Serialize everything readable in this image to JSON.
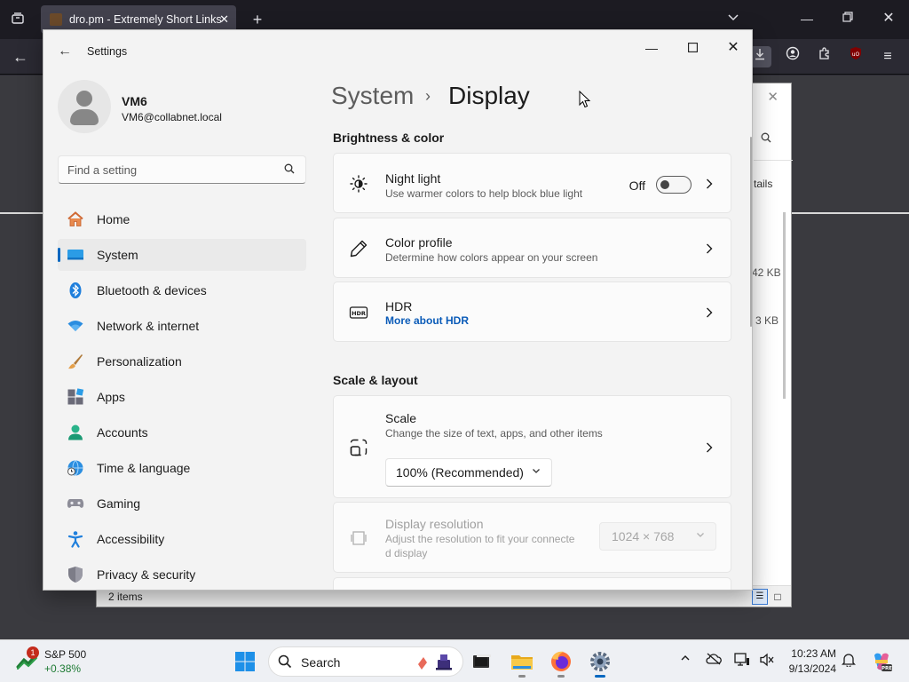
{
  "browser": {
    "tab_title": "dro.pm - Extremely Short Links",
    "downloads": {
      "details_label": "tails",
      "size_1": "42 KB",
      "size_2": "3 KB",
      "status": "2 items"
    }
  },
  "settings": {
    "app_title": "Settings",
    "user": {
      "name": "VM6",
      "email": "VM6@collabnet.local"
    },
    "search": {
      "placeholder": "Find a setting"
    },
    "nav": [
      {
        "label": "Home"
      },
      {
        "label": "System"
      },
      {
        "label": "Bluetooth & devices"
      },
      {
        "label": "Network & internet"
      },
      {
        "label": "Personalization"
      },
      {
        "label": "Apps"
      },
      {
        "label": "Accounts"
      },
      {
        "label": "Time & language"
      },
      {
        "label": "Gaming"
      },
      {
        "label": "Accessibility"
      },
      {
        "label": "Privacy & security"
      }
    ],
    "breadcrumb": {
      "parent": "System",
      "separator": "›",
      "current": "Display"
    },
    "sections": {
      "brightness": {
        "title": "Brightness & color",
        "night_light": {
          "title": "Night light",
          "subtitle": "Use warmer colors to help block blue light",
          "state": "Off"
        },
        "color_profile": {
          "title": "Color profile",
          "subtitle": "Determine how colors appear on your screen"
        },
        "hdr": {
          "title": "HDR",
          "link": "More about HDR"
        }
      },
      "scale_layout": {
        "title": "Scale & layout",
        "scale": {
          "title": "Scale",
          "subtitle": "Change the size of text, apps, and other items",
          "value": "100% (Recommended)"
        },
        "resolution": {
          "title": "Display resolution",
          "subtitle_line1": "Adjust the resolution to fit your connecte",
          "subtitle_line2": "d display",
          "value": "1024 × 768"
        }
      }
    }
  },
  "taskbar": {
    "stock": {
      "badge": "1",
      "name": "S&P 500",
      "change": "+0.38%"
    },
    "search_label": "Search",
    "clock": {
      "time": "10:23 AM",
      "date": "9/13/2024"
    }
  },
  "colors": {
    "accent": "#0067c0",
    "link": "#0a5bb8",
    "stock_up": "#1e7b34",
    "badge": "#c42b1c"
  },
  "icons": {
    "night_light": "brightness-icon",
    "color_profile": "pen-icon",
    "hdr": "hdr-icon",
    "scale": "scale-icon",
    "resolution": "resolution-icon"
  }
}
